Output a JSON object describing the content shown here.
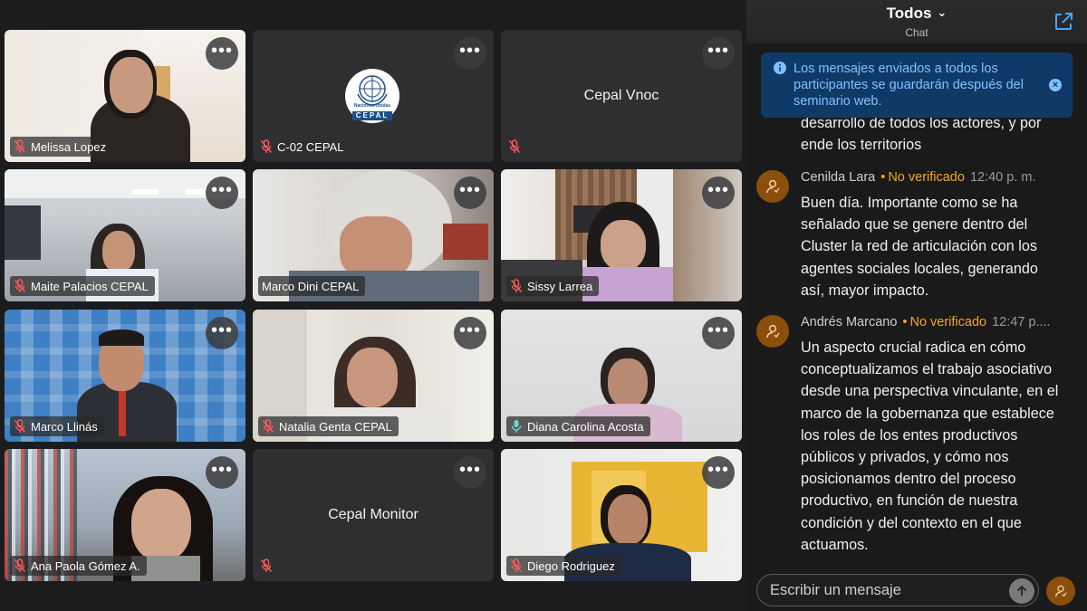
{
  "participants": [
    {
      "name": "Melissa Lopez",
      "type": "video"
    },
    {
      "name": "C-02 CEPAL",
      "type": "logo",
      "logo_text": "Naciones Unidas",
      "logo_sub": "CEPAL"
    },
    {
      "name": "Cepal Vnoc",
      "type": "name-only"
    },
    {
      "name": "Maite Palacios CEPAL",
      "type": "video"
    },
    {
      "name": "Marco Dini CEPAL",
      "type": "video"
    },
    {
      "name": "Sissy Larrea",
      "type": "video"
    },
    {
      "name": "Marco Llinás",
      "type": "video"
    },
    {
      "name": "Natalia Genta CEPAL",
      "type": "video"
    },
    {
      "name": "Diana Carolina Acosta",
      "type": "video",
      "speaking": true
    },
    {
      "name": "Ana Paola Gómez A.",
      "type": "video"
    },
    {
      "name": "Cepal Monitor",
      "type": "name-only"
    },
    {
      "name": "Diego Rodriguez",
      "type": "video"
    }
  ],
  "tile_menu_label": "•••",
  "chat": {
    "title": "Todos",
    "subtitle": "Chat",
    "notice": "Los mensajes enviados a todos los participantes se guardarán después del seminario web.",
    "partial_message": [
      "desarrollo de todos los actores, y por",
      "ende los territorios"
    ],
    "messages": [
      {
        "author": "Cenilda Lara",
        "badge": "No verificado",
        "time": "12:40 p. m.",
        "lines": [
          "Buen día.  Importante como se ha",
          "señalado que se genere dentro del",
          "Cluster  la red de articulación con los",
          "agentes sociales  locales,  generando",
          "así, mayor impacto."
        ]
      },
      {
        "author": "Andrés Marcano",
        "badge": "No verificado",
        "time": "12:47 p....",
        "lines": [
          "Un aspecto crucial radica en cómo",
          "conceptualizamos el trabajo asociativo",
          "desde una perspectiva vinculante, en el",
          "marco de la gobernanza que establece",
          "los roles de los entes productivos",
          "públicos y privados, y cómo nos",
          "posicionamos dentro del proceso",
          "productivo, en función de nuestra",
          "condición y del contexto en el que",
          "actuamos."
        ]
      }
    ],
    "input_placeholder": "Escribir un mensaje"
  },
  "colors": {
    "accent_speaking": "#6fd7d3",
    "unverified": "#f5a623",
    "notice_bg": "#0f3a68",
    "notice_text": "#7fc1ff"
  }
}
